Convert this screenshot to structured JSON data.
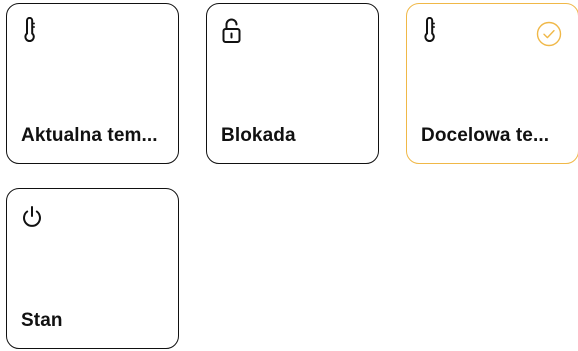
{
  "tiles": [
    {
      "label": "Aktualna tem...",
      "icon": "thermometer-icon",
      "selected": false
    },
    {
      "label": "Blokada",
      "icon": "unlocked-padlock-icon",
      "selected": false
    },
    {
      "label": "Docelowa te...",
      "icon": "thermometer-icon",
      "selected": true,
      "selected_icon": "check-circle-icon"
    },
    {
      "label": "Stan",
      "icon": "power-icon",
      "selected": false
    }
  ],
  "colors": {
    "border": "#111111",
    "selected_border": "#f0b848",
    "text": "#111111",
    "background": "#ffffff"
  }
}
